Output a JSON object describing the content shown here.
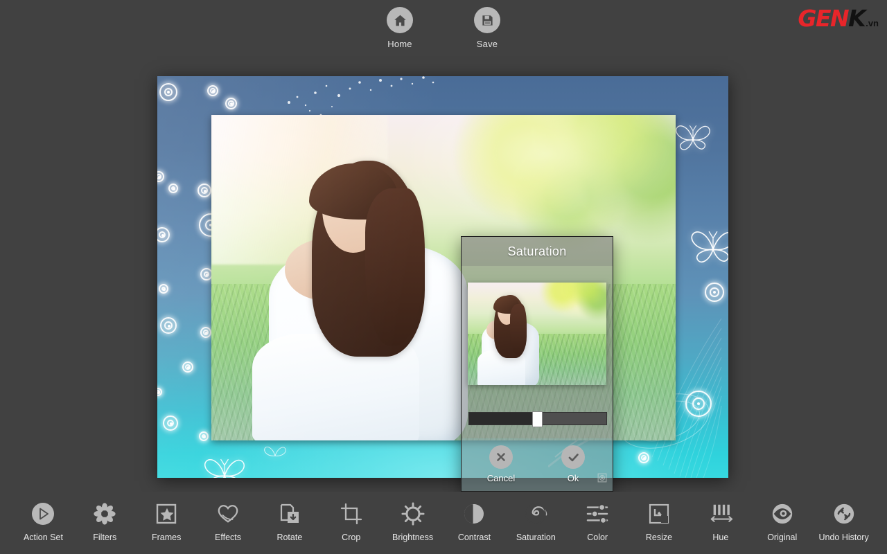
{
  "app": {
    "background_color": "#414141",
    "accent_icon_color": "#b8b8b8",
    "text_color": "#e9e9e9"
  },
  "logo": {
    "part1": "GEN",
    "part2": "K",
    "suffix": ".vn",
    "color1": "#e8252a",
    "color2": "#111111"
  },
  "top_toolbar": {
    "items": [
      {
        "label": "Home",
        "icon": "home-icon"
      },
      {
        "label": "Save",
        "icon": "save-floppy-icon"
      }
    ]
  },
  "canvas": {
    "frame_name": "blue-butterfly-frame",
    "photo_alt": "woman sitting on grass in white ao dai"
  },
  "dialog": {
    "title": "Saturation",
    "preview_alt": "saturation preview thumbnail",
    "slider": {
      "name": "saturation-slider",
      "value": 50,
      "min": 0,
      "max": 100
    },
    "buttons": [
      {
        "label": "Cancel",
        "icon": "close-x-icon"
      },
      {
        "label": "Ok",
        "icon": "check-icon"
      }
    ],
    "resize_grip": "resize-grip-icon"
  },
  "bottom_toolbar": {
    "items": [
      {
        "label": "Action Set",
        "icon": "play-circle-icon"
      },
      {
        "label": "Filters",
        "icon": "flower-icon"
      },
      {
        "label": "Frames",
        "icon": "frame-star-icon"
      },
      {
        "label": "Effects",
        "icon": "heart-icon"
      },
      {
        "label": "Rotate",
        "icon": "rotate-page-icon"
      },
      {
        "label": "Crop",
        "icon": "crop-icon"
      },
      {
        "label": "Brightness",
        "icon": "sun-icon"
      },
      {
        "label": "Contrast",
        "icon": "contrast-half-circle-icon"
      },
      {
        "label": "Saturation",
        "icon": "spiral-icon"
      },
      {
        "label": "Color",
        "icon": "sliders-icon"
      },
      {
        "label": "Resize",
        "icon": "resize-arrow-icon"
      },
      {
        "label": "Hue",
        "icon": "hue-bars-icon"
      },
      {
        "label": "Original",
        "icon": "eye-icon"
      },
      {
        "label": "Undo History",
        "icon": "undo-arrows-icon"
      }
    ]
  }
}
